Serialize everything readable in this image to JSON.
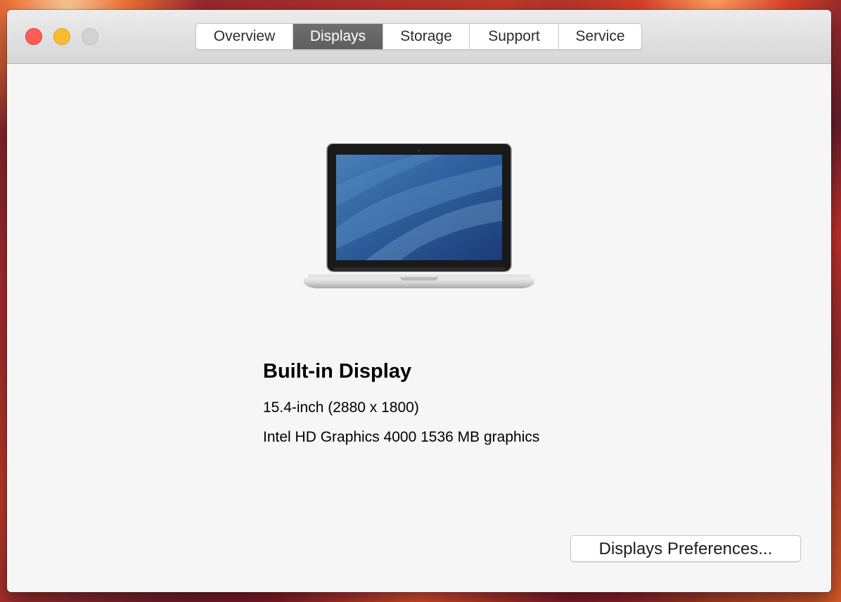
{
  "window": {
    "traffic_lights": [
      {
        "name": "close",
        "color": "#fc5d56"
      },
      {
        "name": "minimize",
        "color": "#fdbc2e"
      },
      {
        "name": "zoom",
        "color": "#d2d2d2"
      }
    ]
  },
  "tabs": [
    {
      "label": "Overview",
      "active": false
    },
    {
      "label": "Displays",
      "active": true
    },
    {
      "label": "Storage",
      "active": false
    },
    {
      "label": "Support",
      "active": false
    },
    {
      "label": "Service",
      "active": false
    }
  ],
  "display": {
    "icon": "laptop-icon",
    "title": "Built-in Display",
    "size": "15.4-inch (2880 x 1800)",
    "graphics": "Intel HD Graphics 4000 1536 MB graphics"
  },
  "buttons": {
    "preferences": "Displays Preferences..."
  },
  "colors": {
    "active_tab": "#666666",
    "window_bg": "#f6f6f6"
  }
}
